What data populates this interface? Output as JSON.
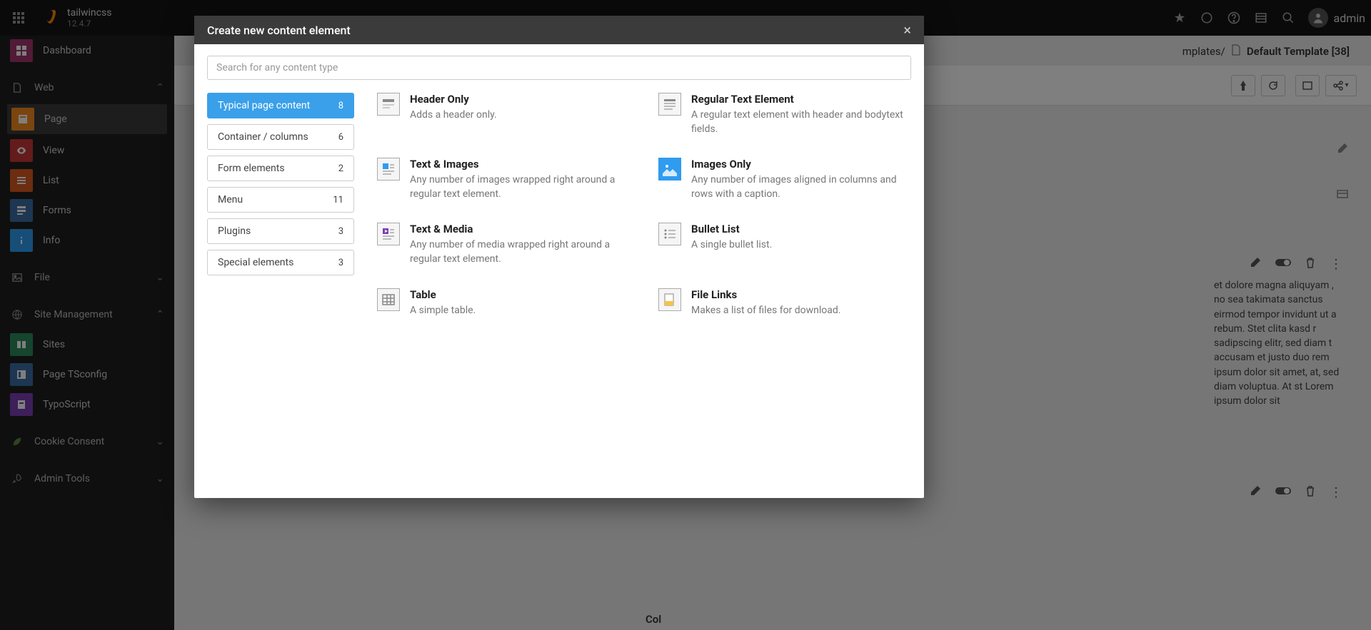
{
  "brand": {
    "name": "tailwincss",
    "version": "12.4.7"
  },
  "user": {
    "name": "admin"
  },
  "sidebar": {
    "dashboard": "Dashboard",
    "groups": {
      "web": "Web",
      "file": "File",
      "site_management": "Site Management",
      "cookie_consent": "Cookie Consent",
      "admin_tools": "Admin Tools"
    },
    "web_items": {
      "page": "Page",
      "view": "View",
      "list": "List",
      "forms": "Forms",
      "info": "Info"
    },
    "site_items": {
      "sites": "Sites",
      "page_tsconfig": "Page TSconfig",
      "typoscript": "TypoScript"
    }
  },
  "breadcrumb": {
    "tail": "mplates/",
    "current": "Default Template [38]"
  },
  "bg": {
    "lorem": "et dolore magna aliquyam , no sea takimata sanctus eirmod tempor invidunt ut a rebum. Stet clita kasd r sadipscing elitr, sed diam t accusam et justo duo rem ipsum dolor sit amet, at, sed diam voluptua. At st Lorem ipsum dolor sit",
    "col": "Col"
  },
  "modal": {
    "title": "Create new content element",
    "search_placeholder": "Search for any content type",
    "categories": [
      {
        "label": "Typical page content",
        "count": 8,
        "active": true
      },
      {
        "label": "Container / columns",
        "count": 6
      },
      {
        "label": "Form elements",
        "count": 2
      },
      {
        "label": "Menu",
        "count": 11
      },
      {
        "label": "Plugins",
        "count": 3
      },
      {
        "label": "Special elements",
        "count": 3
      }
    ],
    "elements": [
      {
        "title": "Header Only",
        "desc": "Adds a header only.",
        "icon": "header"
      },
      {
        "title": "Regular Text Element",
        "desc": "A regular text element with header and bodytext fields.",
        "icon": "text"
      },
      {
        "title": "Text & Images",
        "desc": "Any number of images wrapped right around a regular text element.",
        "icon": "textpic"
      },
      {
        "title": "Images Only",
        "desc": "Any number of images aligned in columns and rows with a caption.",
        "icon": "image"
      },
      {
        "title": "Text & Media",
        "desc": "Any number of media wrapped right around a regular text element.",
        "icon": "media"
      },
      {
        "title": "Bullet List",
        "desc": "A single bullet list.",
        "icon": "bullets"
      },
      {
        "title": "Table",
        "desc": "A simple table.",
        "icon": "table"
      },
      {
        "title": "File Links",
        "desc": "Makes a list of files for download.",
        "icon": "files"
      }
    ]
  }
}
